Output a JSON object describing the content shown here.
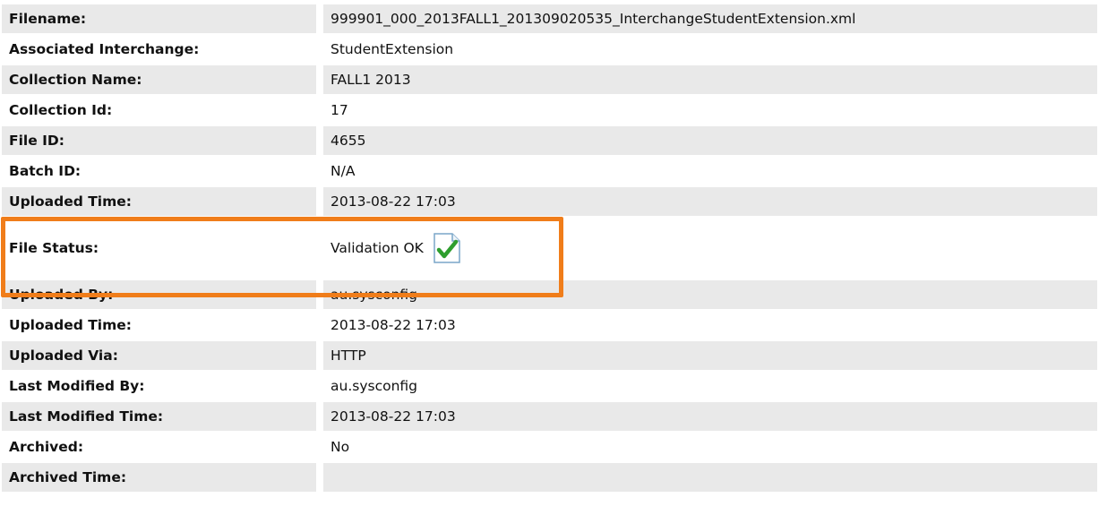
{
  "rows": [
    {
      "label": "Filename:",
      "value": "999901_000_2013FALL1_201309020535_InterchangeStudentExtension.xml"
    },
    {
      "label": "Associated Interchange:",
      "value": "StudentExtension"
    },
    {
      "label": "Collection Name:",
      "value": "FALL1 2013"
    },
    {
      "label": "Collection Id:",
      "value": "17"
    },
    {
      "label": "File ID:",
      "value": "4655"
    },
    {
      "label": "Batch ID:",
      "value": "N/A"
    },
    {
      "label": "Uploaded Time:",
      "value": "2013-08-22 17:03"
    },
    {
      "label": "File Status:",
      "value": "Validation OK"
    },
    {
      "label": "Uploaded By:",
      "value": "au.sysconfig"
    },
    {
      "label": "Uploaded Time:",
      "value": "2013-08-22 17:03"
    },
    {
      "label": "Uploaded Via:",
      "value": "HTTP"
    },
    {
      "label": "Last Modified By:",
      "value": "au.sysconfig"
    },
    {
      "label": "Last Modified Time:",
      "value": "2013-08-22 17:03"
    },
    {
      "label": "Archived:",
      "value": "No"
    },
    {
      "label": "Archived Time:",
      "value": ""
    }
  ],
  "status_icon": "validation-ok-check-icon",
  "colors": {
    "row_gray": "#e9e9e9",
    "highlight": "#f07d1a",
    "check_green": "#2e9e2e"
  }
}
